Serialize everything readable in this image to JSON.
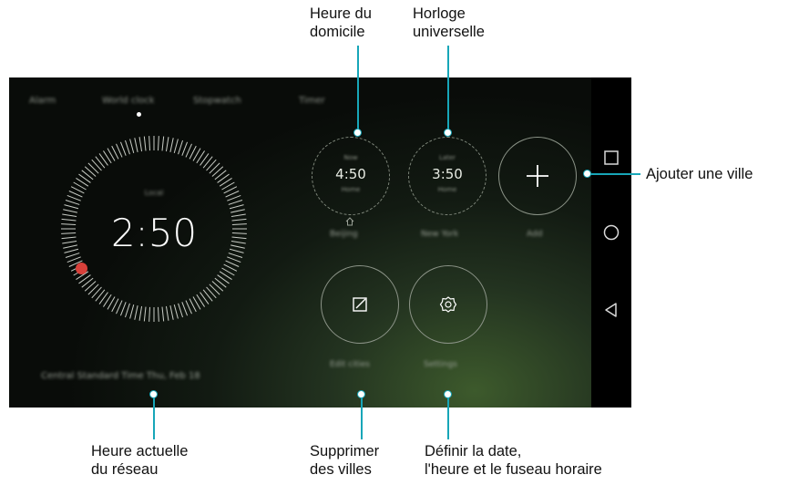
{
  "tabs": [
    "Alarm",
    "World clock",
    "Stopwatch",
    "Timer"
  ],
  "main_clock": {
    "top_text": "Local",
    "time": "2:50",
    "network_time": "Central Standard Time Thu, Feb 18"
  },
  "home_clock": {
    "top": "Now",
    "time": "4:50",
    "bottom": "Home",
    "city": "Beijing"
  },
  "world_clock": {
    "top": "Later",
    "time": "3:50",
    "bottom": "Home",
    "city": "New York"
  },
  "add_city_label": "Add",
  "edit_cities_label": "Edit cities",
  "settings_label": "Settings",
  "annotations": {
    "home_time": [
      "Heure du",
      "domicile"
    ],
    "world_clock": [
      "Horloge",
      "universelle"
    ],
    "add_city": "Ajouter une ville",
    "network_time": [
      "Heure actuelle",
      "du réseau"
    ],
    "delete_cities": [
      "Supprimer",
      "des villes"
    ],
    "set_datetime": [
      "Définir la date,",
      "l'heure et le fuseau horaire"
    ]
  },
  "colors": {
    "accent_line": "#17a6b8",
    "red_dot": "#d8403a",
    "screen_bg": "#0f150f"
  },
  "icons": [
    "home-icon",
    "plus-icon",
    "edit-icon",
    "settings-gear-icon",
    "recent-apps-icon",
    "home-nav-icon",
    "back-icon"
  ]
}
